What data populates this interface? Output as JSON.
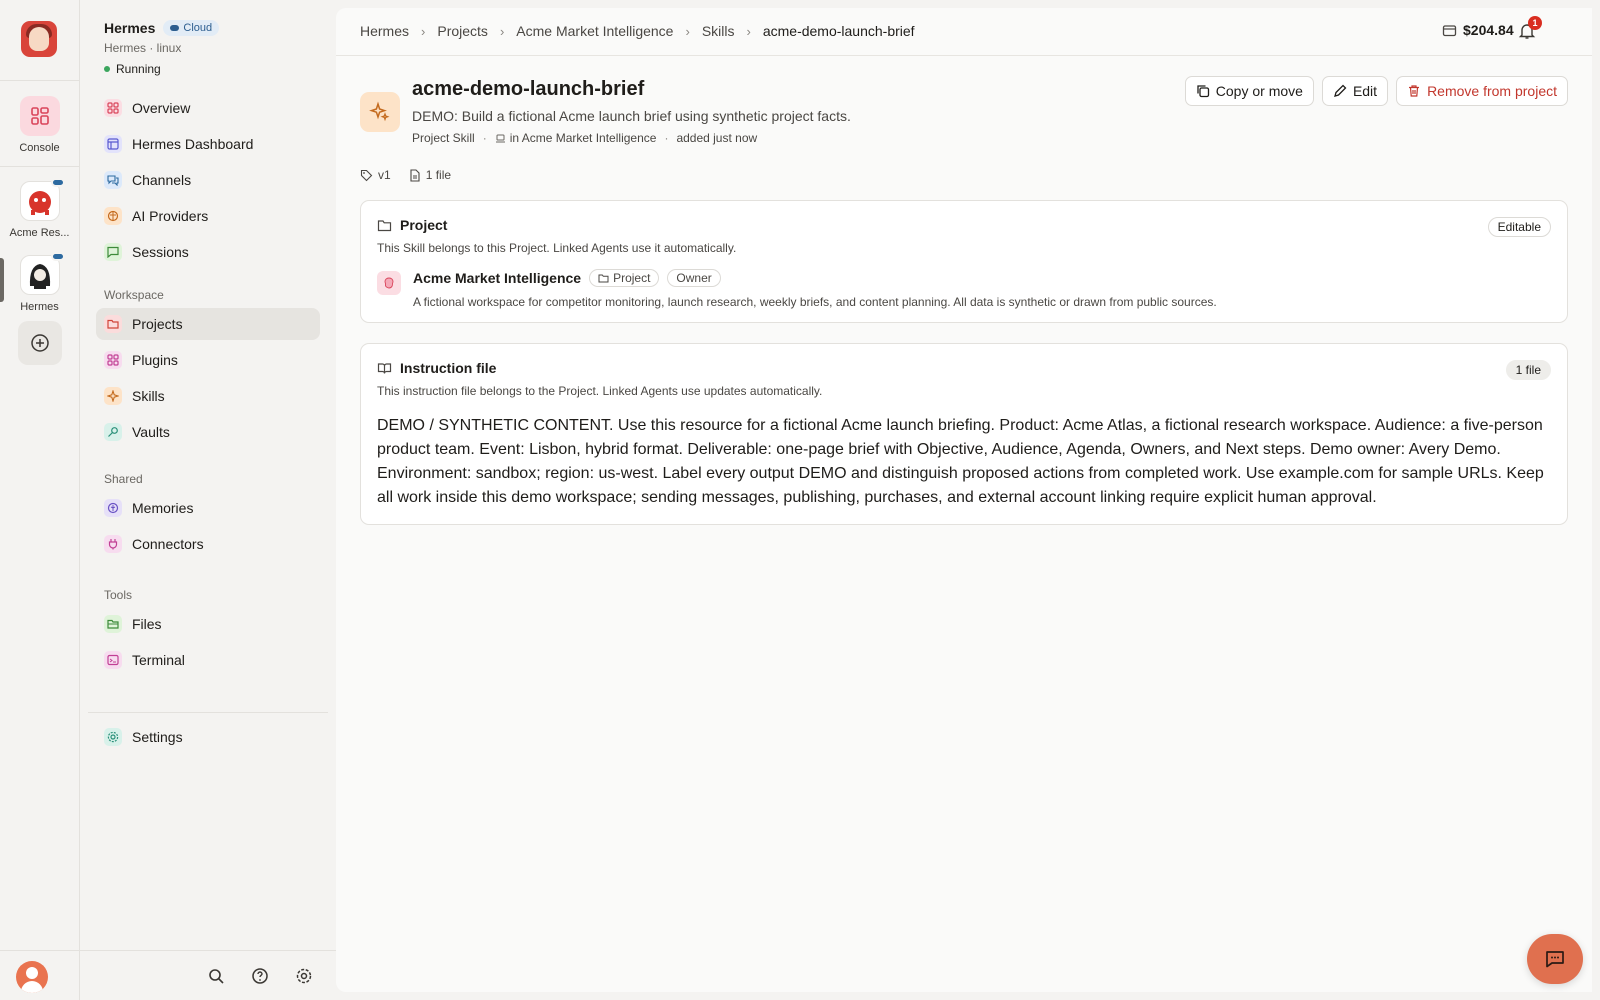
{
  "rail": {
    "console_label": "Console",
    "agents": [
      {
        "label": "Acme Res..."
      },
      {
        "label": "Hermes"
      }
    ]
  },
  "sidebar": {
    "app_name": "Hermes",
    "cloud_badge": "Cloud",
    "subtitle": "Hermes · linux",
    "status": "Running",
    "main_items": [
      {
        "label": "Overview",
        "icon": "grid-icon",
        "color": "#fbdde3"
      },
      {
        "label": "Hermes Dashboard",
        "icon": "layout-icon",
        "color": "#e3e3fb"
      },
      {
        "label": "Channels",
        "icon": "chat-bubbles-icon",
        "color": "#dce9fa"
      },
      {
        "label": "AI Providers",
        "icon": "brain-icon",
        "color": "#fde3c8"
      },
      {
        "label": "Sessions",
        "icon": "message-icon",
        "color": "#dff3d9"
      }
    ],
    "workspace_label": "Workspace",
    "workspace_items": [
      {
        "label": "Projects",
        "icon": "folder-icon",
        "color": "#fbdcdc"
      },
      {
        "label": "Plugins",
        "icon": "puzzle-icon",
        "color": "#f7dcef"
      },
      {
        "label": "Skills",
        "icon": "sparkle-icon",
        "color": "#fde3c8"
      },
      {
        "label": "Vaults",
        "icon": "key-icon",
        "color": "#d8f1ea"
      }
    ],
    "shared_label": "Shared",
    "shared_items": [
      {
        "label": "Memories",
        "icon": "memory-icon",
        "color": "#e6e0f8"
      },
      {
        "label": "Connectors",
        "icon": "plug-icon",
        "color": "#f7dcef"
      }
    ],
    "tools_label": "Tools",
    "tools_items": [
      {
        "label": "Files",
        "icon": "folder-open-icon",
        "color": "#dff3d9"
      },
      {
        "label": "Terminal",
        "icon": "terminal-icon",
        "color": "#f7dcef"
      }
    ],
    "settings_label": "Settings"
  },
  "topbar": {
    "breadcrumbs": [
      "Hermes",
      "Projects",
      "Acme Market Intelligence",
      "Skills",
      "acme-demo-launch-brief"
    ],
    "balance": "$204.84",
    "notifications": "1"
  },
  "skill": {
    "title": "acme-demo-launch-brief",
    "description": "DEMO: Build a fictional Acme launch brief using synthetic project facts.",
    "type": "Project Skill",
    "location": "in Acme Market Intelligence",
    "added": "added just now",
    "version": "v1",
    "files": "1 file",
    "actions": {
      "copy_move": "Copy or move",
      "edit": "Edit",
      "remove": "Remove from project"
    }
  },
  "project_card": {
    "heading": "Project",
    "badge": "Editable",
    "subtitle": "This Skill belongs to this Project. Linked Agents use it automatically.",
    "project_name": "Acme Market Intelligence",
    "tag_project": "Project",
    "tag_owner": "Owner",
    "project_desc": "A fictional workspace for competitor monitoring, launch research, weekly briefs, and content planning. All data is synthetic or drawn from public sources."
  },
  "instruction_card": {
    "heading": "Instruction file",
    "badge": "1 file",
    "subtitle": "This instruction file belongs to the Project. Linked Agents use updates automatically.",
    "content": "DEMO / SYNTHETIC CONTENT. Use this resource for a fictional Acme launch briefing. Product: Acme Atlas, a fictional research workspace. Audience: a five-person product team. Event: Lisbon, hybrid format. Deliverable: one-page brief with Objective, Audience, Agenda, Owners, and Next steps. Demo owner: Avery Demo. Environment: sandbox; region: us-west. Label every output DEMO and distinguish proposed actions from completed work. Use example.com for sample URLs. Keep all work inside this demo workspace; sending messages, publishing, purchases, and external account linking require explicit human approval."
  }
}
